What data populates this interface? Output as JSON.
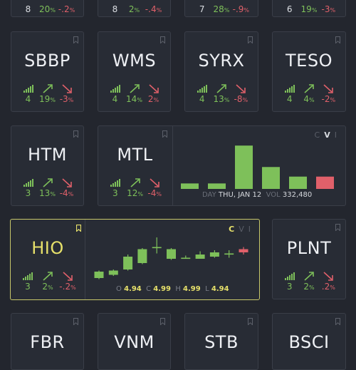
{
  "colors": {
    "green": "#7ec05a",
    "red": "#e0606a",
    "yellow": "#e6e06a",
    "bg": "#23262e",
    "card": "#282c35"
  },
  "top_row": [
    {
      "count": "8",
      "pct": "20",
      "chg": "-.2"
    },
    {
      "count": "8",
      "pct": "2",
      "chg": "-.4"
    },
    {
      "count": "7",
      "pct": "28",
      "chg": "-.9"
    },
    {
      "count": "6",
      "pct": "19",
      "chg": "-3"
    }
  ],
  "cards": {
    "sbbp": {
      "ticker": "SBBP",
      "count": "4",
      "pct": "19",
      "chg": "-3"
    },
    "wms": {
      "ticker": "WMS",
      "count": "4",
      "pct": "14",
      "chg": "2"
    },
    "syrx": {
      "ticker": "SYRX",
      "count": "4",
      "pct": "13",
      "chg": "-8"
    },
    "teso": {
      "ticker": "TESO",
      "count": "4",
      "pct": "4",
      "chg": "-2"
    },
    "htm": {
      "ticker": "HTM",
      "count": "3",
      "pct": "13",
      "chg": "-4"
    },
    "mtl": {
      "ticker": "MTL",
      "count": "3",
      "pct": "12",
      "chg": "-4"
    },
    "hio": {
      "ticker": "HIO",
      "count": "3",
      "pct": "2",
      "chg": "-.2"
    },
    "plnt": {
      "ticker": "PLNT",
      "count": "3",
      "pct": "2",
      "chg": ".2"
    },
    "fbr": {
      "ticker": "FBR"
    },
    "vnm": {
      "ticker": "VNM"
    },
    "stb": {
      "ticker": "STB"
    },
    "bsci": {
      "ticker": "BSCI"
    }
  },
  "pct_unit": "%",
  "mtl_panel": {
    "modes": [
      "C",
      "V",
      "I"
    ],
    "active_mode": "V",
    "day_label": "DAY",
    "day_value": "THU, JAN 12",
    "vol_label": "VOL",
    "vol_value": "332,480",
    "volume_levels": [
      0.12,
      0.12,
      0.95,
      0.48,
      0.27,
      0.27
    ],
    "volume_colors": [
      "green",
      "green",
      "green",
      "green",
      "green",
      "red"
    ]
  },
  "hio_panel": {
    "modes": [
      "C",
      "V",
      "I"
    ],
    "active_mode": "C",
    "o_label": "O",
    "o_value": "4.94",
    "c_label": "C",
    "c_value": "4.99",
    "h_label": "H",
    "h_value": "4.99",
    "l_label": "L",
    "l_value": "4.94",
    "candles": [
      {
        "o": 4.7,
        "c": 4.76,
        "h": 4.77,
        "l": 4.69,
        "color": "green"
      },
      {
        "o": 4.73,
        "c": 4.77,
        "h": 4.78,
        "l": 4.72,
        "color": "green"
      },
      {
        "o": 4.78,
        "c": 4.9,
        "h": 4.92,
        "l": 4.77,
        "color": "green"
      },
      {
        "o": 4.84,
        "c": 4.97,
        "h": 4.98,
        "l": 4.83,
        "color": "green"
      },
      {
        "o": 4.99,
        "c": 4.99,
        "h": 5.08,
        "l": 4.93,
        "color": "green"
      },
      {
        "o": 4.88,
        "c": 4.97,
        "h": 4.98,
        "l": 4.87,
        "color": "green"
      },
      {
        "o": 4.88,
        "c": 4.89,
        "h": 4.91,
        "l": 4.88,
        "color": "green"
      },
      {
        "o": 4.88,
        "c": 4.92,
        "h": 4.95,
        "l": 4.88,
        "color": "green"
      },
      {
        "o": 4.9,
        "c": 4.94,
        "h": 4.96,
        "l": 4.89,
        "color": "green"
      },
      {
        "o": 4.92,
        "c": 4.93,
        "h": 4.96,
        "l": 4.89,
        "color": "green"
      },
      {
        "o": 4.97,
        "c": 4.94,
        "h": 4.99,
        "l": 4.92,
        "color": "red"
      }
    ]
  }
}
